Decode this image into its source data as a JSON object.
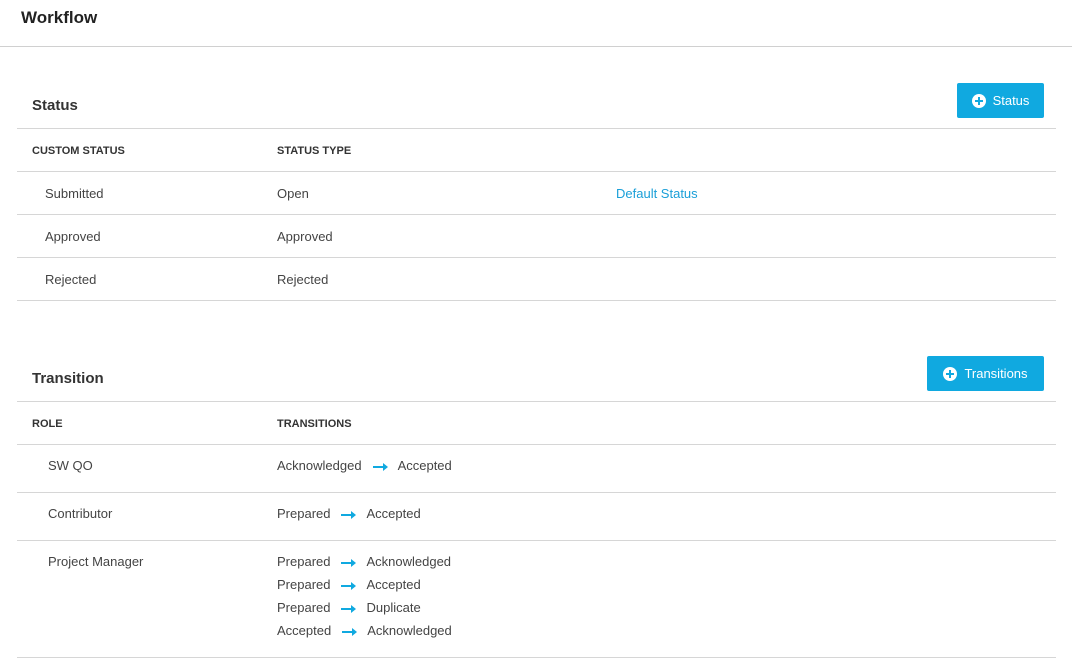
{
  "page": {
    "title": "Workflow"
  },
  "status": {
    "title": "Status",
    "add_button": "Status",
    "columns": [
      "CUSTOM STATUS",
      "STATUS TYPE"
    ],
    "rows": [
      {
        "name": "Submitted",
        "type": "Open",
        "extra": "Default Status"
      },
      {
        "name": "Approved",
        "type": "Approved",
        "extra": ""
      },
      {
        "name": "Rejected",
        "type": "Rejected",
        "extra": ""
      }
    ]
  },
  "transition": {
    "title": "Transition",
    "add_button": "Transitions",
    "columns": [
      "ROLE",
      "TRANSITIONS"
    ],
    "rows": [
      {
        "role": "SW QO",
        "transitions": [
          {
            "from": "Acknowledged",
            "to": "Accepted"
          }
        ]
      },
      {
        "role": "Contributor",
        "transitions": [
          {
            "from": "Prepared",
            "to": "Accepted"
          }
        ]
      },
      {
        "role": "Project Manager",
        "transitions": [
          {
            "from": "Prepared",
            "to": "Acknowledged"
          },
          {
            "from": "Prepared",
            "to": "Accepted"
          },
          {
            "from": "Prepared",
            "to": "Duplicate"
          },
          {
            "from": "Accepted",
            "to": "Acknowledged"
          }
        ]
      }
    ]
  },
  "colors": {
    "accent": "#10a9e0",
    "link": "#1a9fd8",
    "border": "#d6d6d6"
  },
  "icons": {
    "add": "plus-circle-icon",
    "transition_arrow": "arrow-right-icon"
  }
}
